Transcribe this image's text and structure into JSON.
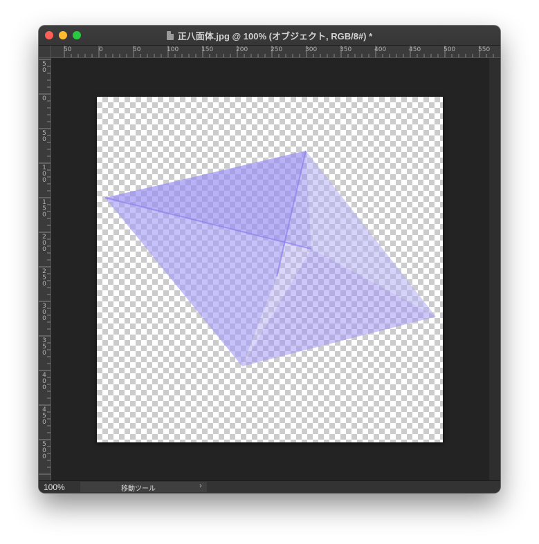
{
  "window": {
    "title": "正八面体.jpg @ 100% (オブジェクト, RGB/8#) *",
    "file_icon": "document-icon"
  },
  "ruler_top": {
    "labels": [
      "50",
      "0",
      "50",
      "100",
      "150",
      "200",
      "250",
      "300",
      "350",
      "400",
      "450",
      "500",
      "550"
    ]
  },
  "ruler_left": {
    "labels": [
      "50",
      "0",
      "50",
      "100",
      "150",
      "200",
      "250",
      "300",
      "350",
      "400",
      "450",
      "500"
    ]
  },
  "status": {
    "zoom": "100%",
    "tool": "移動ツール",
    "arrow_icon": "chevron-right-icon"
  },
  "colors": {
    "shape_face_light": "#b6b0f6",
    "shape_face_mid": "#9b92f4",
    "shape_face_dark": "#8a7ef2",
    "edge": "#8c7ff0"
  }
}
